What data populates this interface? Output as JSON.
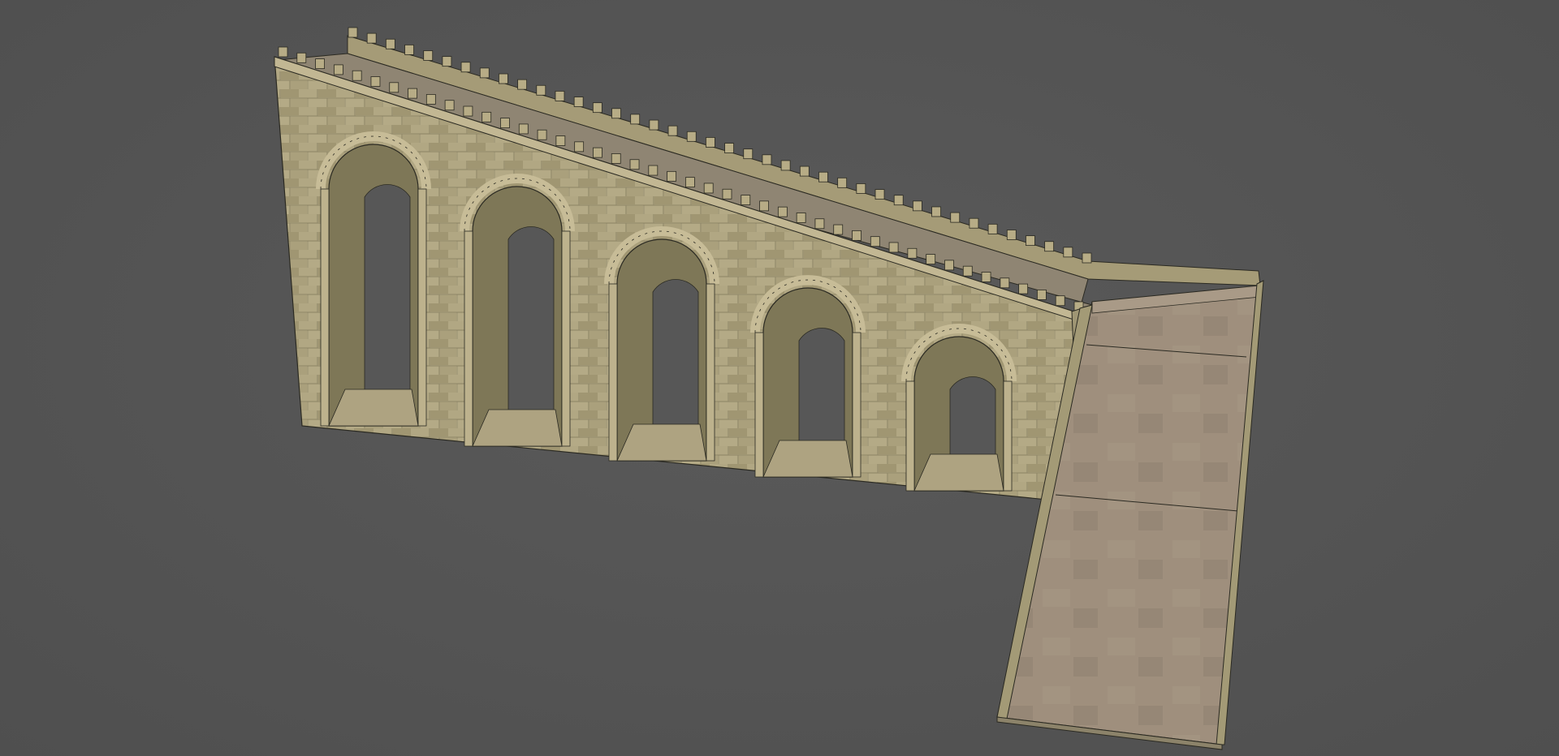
{
  "viewport": {
    "background": "#555555"
  },
  "model": {
    "subject": "stone-arcade-wall-with-ramp",
    "arch_count": 5,
    "colors": {
      "stone_light": "#b7ac86",
      "stone_mid": "#9a9170",
      "stone_dark": "#6f6a52",
      "arch_inner": "#7e7757",
      "ramp_floor": "#9e8e7c",
      "ramp_floor_dark": "#8c7e6d",
      "wireframe": "#2b2a22"
    }
  }
}
